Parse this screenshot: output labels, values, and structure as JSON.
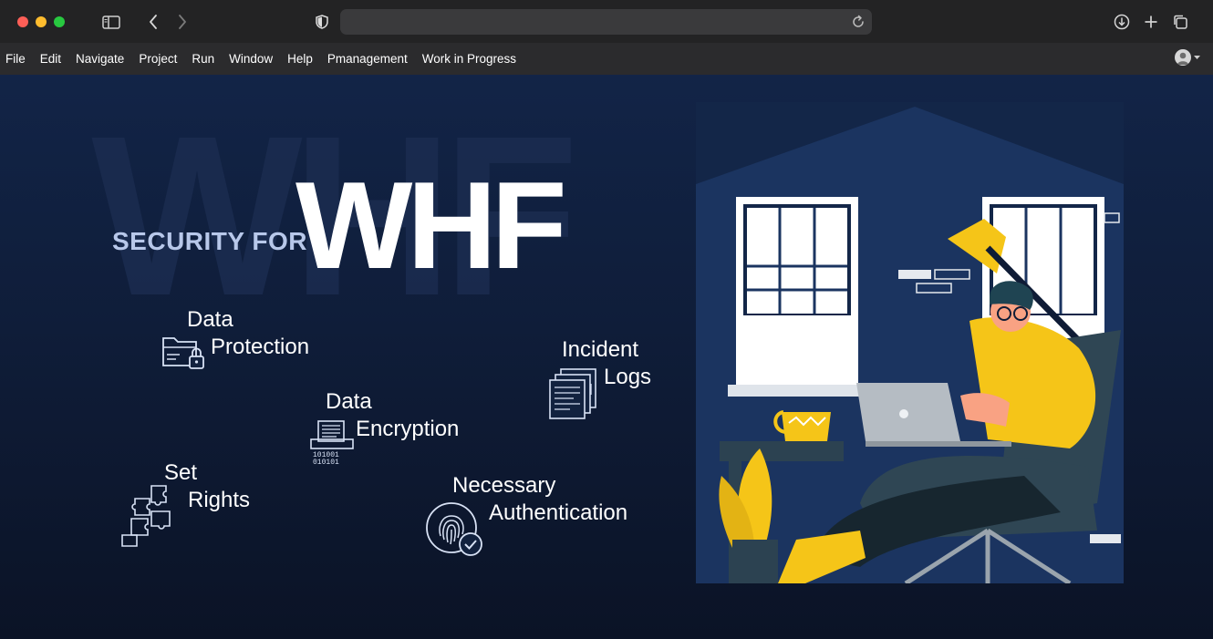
{
  "browser": {
    "window_controls": [
      "close",
      "minimize",
      "zoom"
    ],
    "toolbar_icons": [
      "sidebar-icon",
      "back-icon",
      "forward-icon",
      "shield-icon",
      "reload-icon",
      "download-icon",
      "new-tab-icon",
      "tabs-overview-icon"
    ],
    "address_value": ""
  },
  "menu": {
    "items": [
      "File",
      "Edit",
      "Navigate",
      "Project",
      "Run",
      "Window",
      "Help",
      "Pmanagement",
      "Work in Progress"
    ]
  },
  "banner": {
    "headline_small": "SECURITY FOR",
    "headline_big": "WHF",
    "background_letters": "WHF",
    "features": [
      {
        "line1": "Data",
        "line2": "Protection",
        "icon": "folder-lock-icon"
      },
      {
        "line1": "Data",
        "line2": "Encryption",
        "icon": "document-encryption-icon"
      },
      {
        "line1": "Incident",
        "line2": "Logs",
        "icon": "log-sheets-icon"
      },
      {
        "line1": "Set",
        "line2": "Rights",
        "icon": "puzzle-icon"
      },
      {
        "line1": "Necessary",
        "line2": "Authentication",
        "icon": "fingerprint-check-icon"
      }
    ],
    "illustration": "person-working-on-laptop-illustration"
  },
  "colors": {
    "background": "#0f1d39",
    "accent_yellow": "#f5c518",
    "headline_small": "#b8c8ea",
    "text": "#ffffff"
  }
}
